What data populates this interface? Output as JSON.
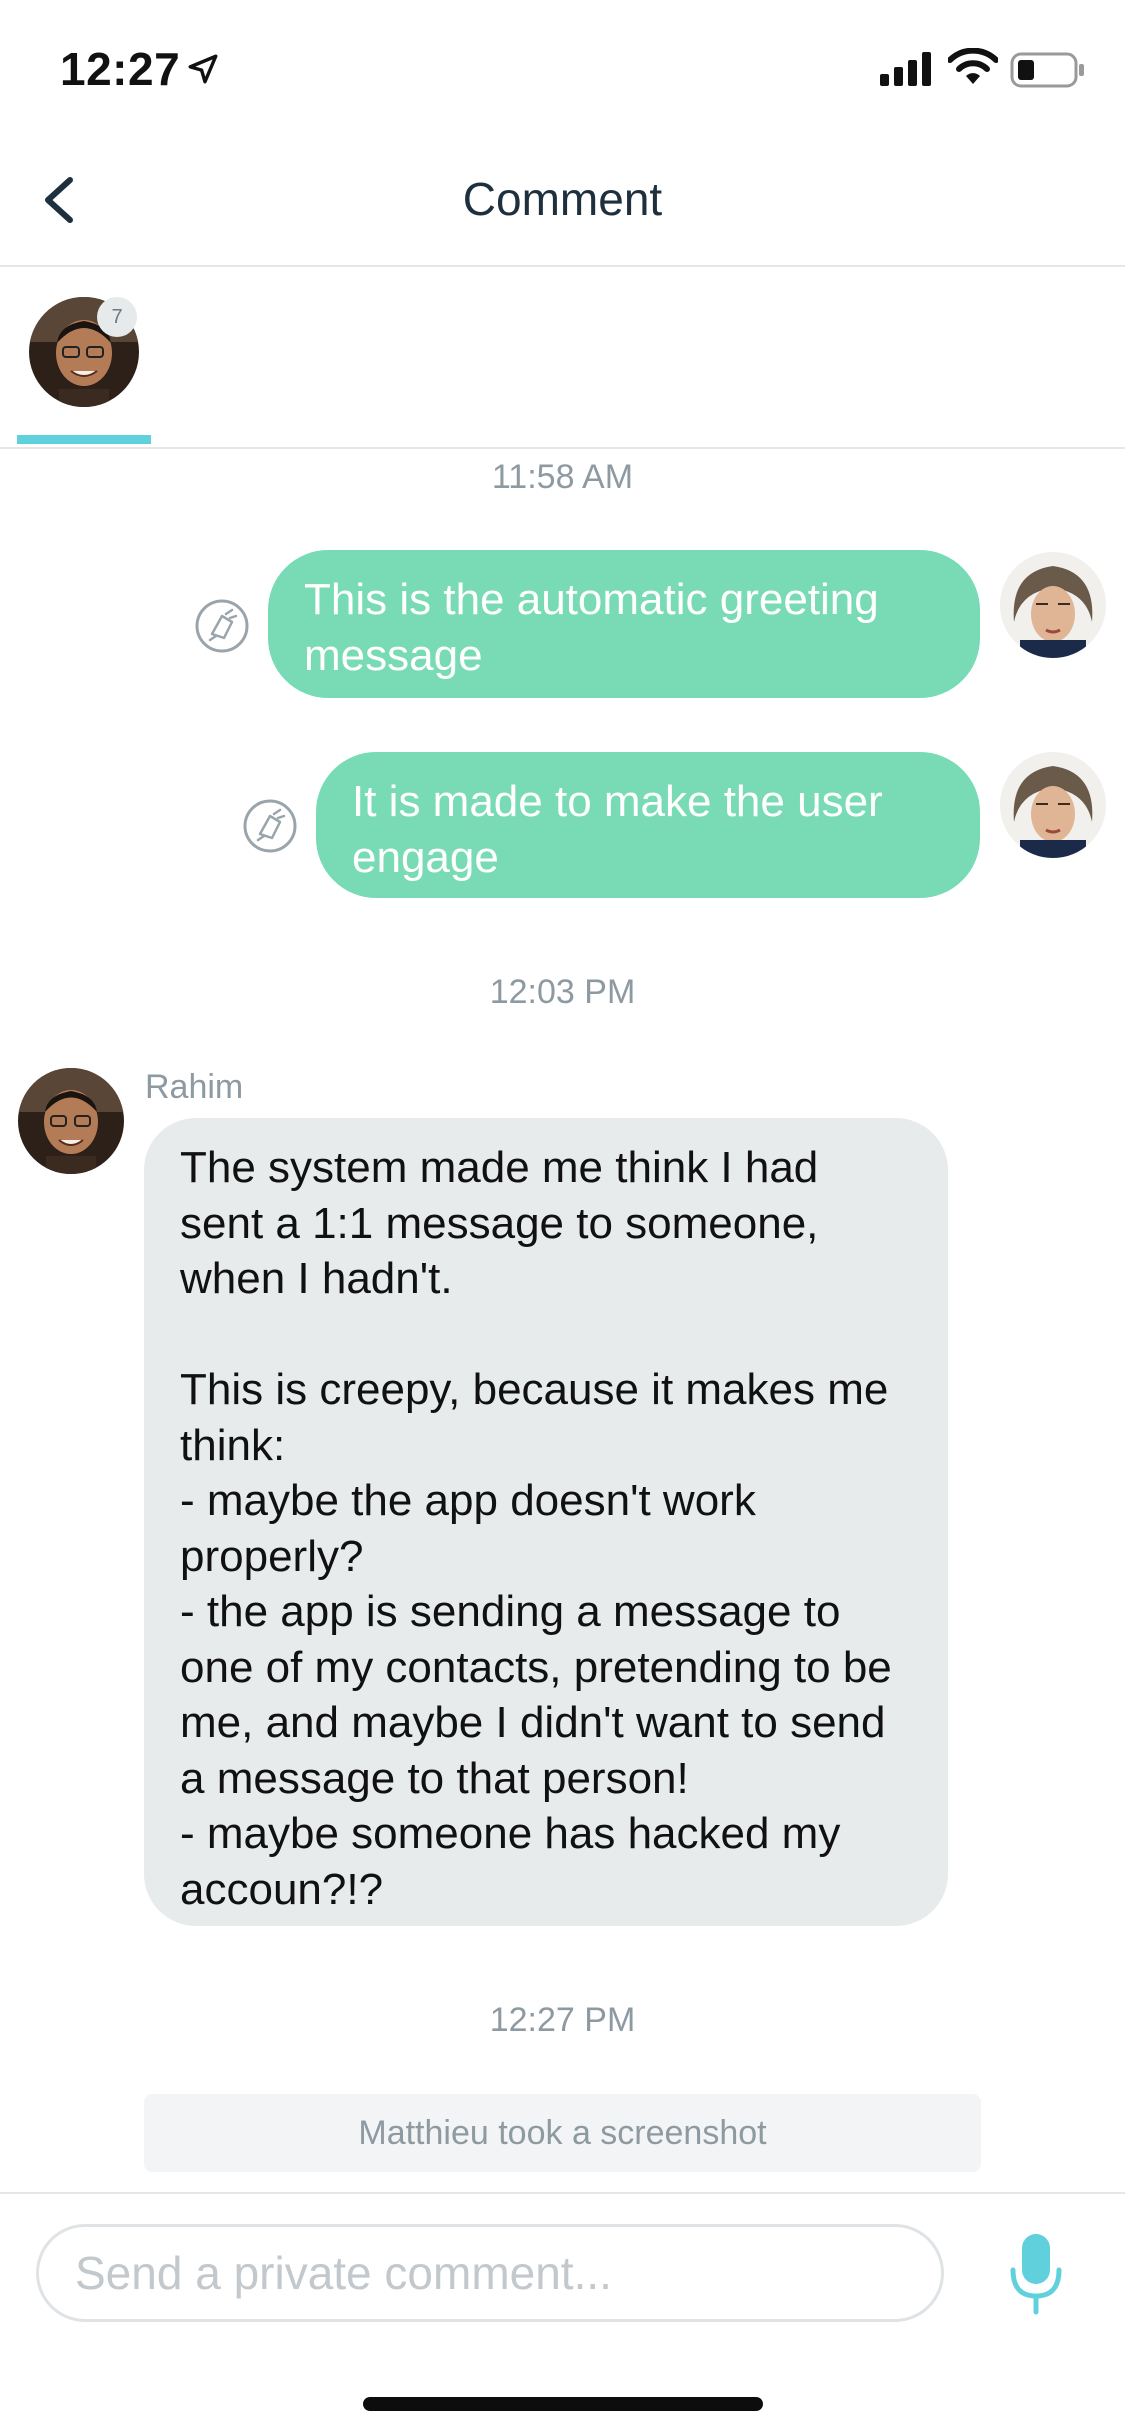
{
  "status_bar": {
    "time": "12:27",
    "icons": [
      "location-arrow-icon",
      "signal-icon",
      "wifi-icon",
      "battery-icon"
    ]
  },
  "nav": {
    "title": "Comment",
    "back_icon": "chevron-left-icon"
  },
  "participants": {
    "count_badge": "7"
  },
  "messages": {
    "timestamp_1": "11:58 AM",
    "outgoing_1": "This is the automatic greeting message",
    "outgoing_2": "It is made to make the user engage",
    "timestamp_2": "12:03 PM",
    "incoming_sender": "Rahim",
    "incoming_text": "The system made me think I had sent a 1:1 message to someone, when I hadn't.\n\nThis is creepy, because it makes me think:\n- maybe the app doesn't work properly?\n- the app is sending a message to one of my contacts, pretending to be me, and maybe I didn't want to send a message to that person!\n- maybe someone has hacked my accoun?!?",
    "timestamp_3": "12:27 PM",
    "system_notice": "Matthieu took a screenshot"
  },
  "composer": {
    "placeholder": "Send a private comment...",
    "mic_icon": "microphone-icon"
  },
  "colors": {
    "outgoing_bubble": "#79dbb6",
    "incoming_bubble": "#e7ebec",
    "accent": "#5fd0dc",
    "title": "#1e2f3d",
    "muted_text": "#8e9aa1"
  }
}
